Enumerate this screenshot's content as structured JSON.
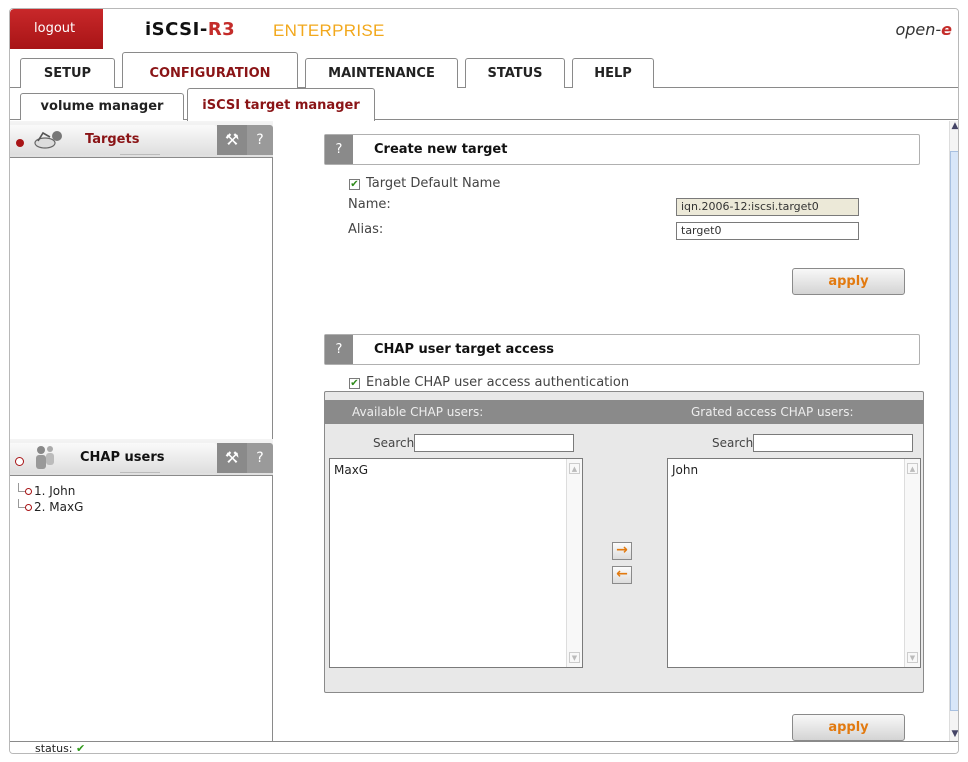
{
  "header": {
    "logout_label": "logout",
    "brand_prefix": "iSCSI-",
    "brand_suffix": "R3",
    "edition": "ENTERPRISE",
    "vendor_prefix": "open-",
    "vendor_suffix": "e"
  },
  "main_tabs": [
    "SETUP",
    "CONFIGURATION",
    "MAINTENANCE",
    "STATUS",
    "HELP"
  ],
  "active_main_tab": "CONFIGURATION",
  "sub_tabs": [
    "volume manager",
    "iSCSI target manager"
  ],
  "active_sub_tab": "iSCSI target manager",
  "left_panel": {
    "targets_title": "Targets",
    "chap_title": "CHAP users",
    "help_glyph": "?",
    "chap_users": [
      "1. John",
      "2. MaxG"
    ]
  },
  "create_target": {
    "title": "Create new target",
    "help_glyph": "?",
    "default_name_label": "Target Default Name",
    "default_name_checked": true,
    "name_label": "Name:",
    "name_value": "iqn.2006-12:iscsi.target0",
    "alias_label": "Alias:",
    "alias_value": "target0",
    "apply_label": "apply"
  },
  "chap_access": {
    "title": "CHAP user target access",
    "help_glyph": "?",
    "enable_label": "Enable CHAP user access authentication",
    "enable_checked": true,
    "available_header": "Available CHAP users:",
    "granted_header": "Grated access CHAP users:",
    "search_label": "Search",
    "available_users": [
      "MaxG"
    ],
    "granted_users": [
      "John"
    ],
    "apply_label": "apply"
  },
  "status": {
    "label": "status:",
    "icon": "check-icon"
  },
  "colors": {
    "brand_red": "#a81416",
    "edition_orange": "#f2a81c",
    "button_text": "#e27a10",
    "status_green": "#2f9a1a"
  }
}
